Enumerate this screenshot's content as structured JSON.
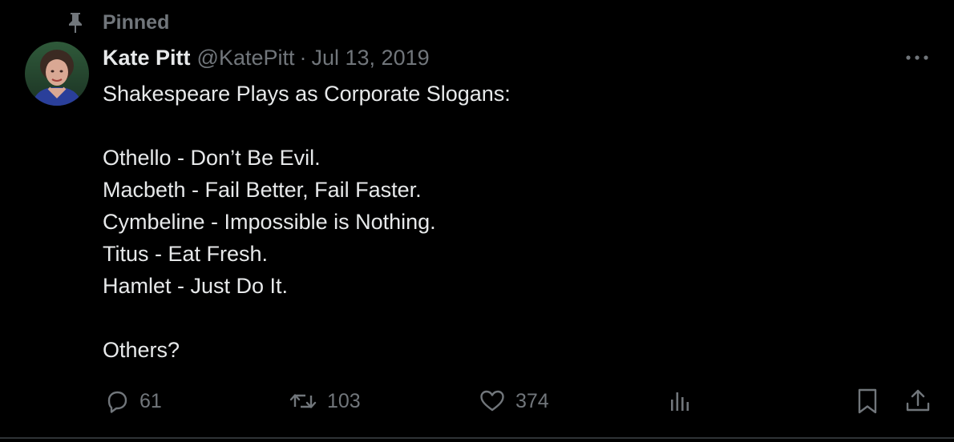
{
  "colors": {
    "background": "#000000",
    "primary_text": "#e7e9ea",
    "secondary_text": "#71767b",
    "divider": "#2f3336"
  },
  "pinned": {
    "icon": "pin-icon",
    "label": "Pinned"
  },
  "author": {
    "avatar": "avatar-photo",
    "display_name": "Kate Pitt",
    "handle": "@KatePitt",
    "separator": "·",
    "date": "Jul 13, 2019"
  },
  "more_icon": "more-horizontal-icon",
  "tweet": {
    "lines": [
      "Shakespeare Plays as Corporate Slogans:",
      "",
      "Othello - Don’t Be Evil.",
      "Macbeth - Fail Better, Fail Faster.",
      "Cymbeline - Impossible is Nothing.",
      "Titus - Eat Fresh.",
      "Hamlet - Just Do It.",
      "",
      "Others?"
    ]
  },
  "actions": {
    "reply": {
      "icon": "reply-icon",
      "count": "61"
    },
    "retweet": {
      "icon": "retweet-icon",
      "count": "103"
    },
    "like": {
      "icon": "heart-icon",
      "count": "374"
    },
    "views": {
      "icon": "analytics-icon"
    },
    "bookmark": {
      "icon": "bookmark-icon"
    },
    "share": {
      "icon": "share-icon"
    }
  }
}
